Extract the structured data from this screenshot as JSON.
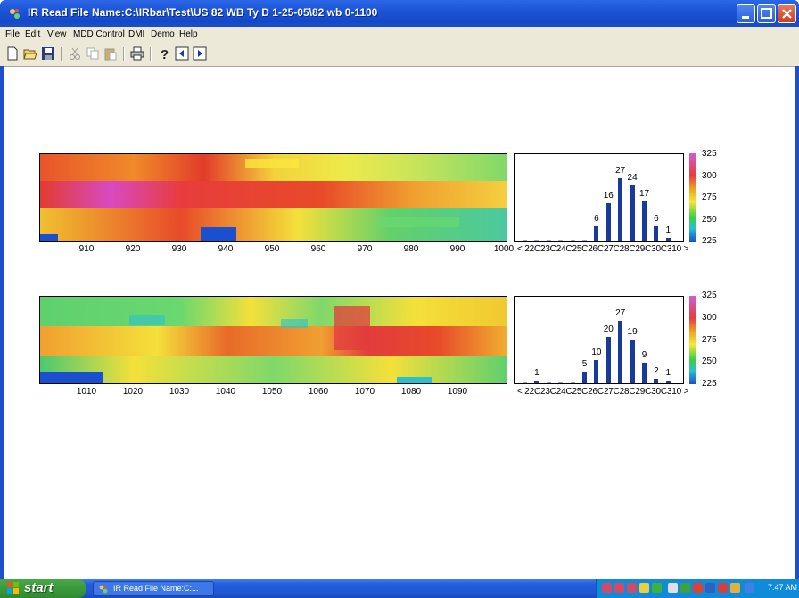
{
  "window": {
    "title": "IR Read File Name:C:\\IRbar\\Test\\US 82 WB Ty D 1-25-05\\82 wb 0-1100"
  },
  "menu": [
    "File",
    "Edit",
    "View",
    "MDD Control",
    "DMI",
    "Demo",
    "Help"
  ],
  "toolbar": {
    "icons": [
      "new-icon",
      "open-icon",
      "save-icon",
      "cut-icon",
      "copy-icon",
      "paste-icon",
      "print-icon",
      "help-icon",
      "previous-icon",
      "next-icon"
    ]
  },
  "heatmaps": [
    {
      "ticks": [
        "910",
        "920",
        "930",
        "940",
        "950",
        "960",
        "970",
        "980",
        "990",
        "1000"
      ]
    },
    {
      "ticks": [
        "1010",
        "1020",
        "1030",
        "1040",
        "1050",
        "1060",
        "1070",
        "1080",
        "1090"
      ]
    }
  ],
  "chart_data": [
    {
      "type": "bar",
      "categories": [
        "<",
        "22",
        "23",
        "24",
        "25",
        "26",
        "27",
        "28",
        "29",
        "30",
        "31",
        "0",
        ">"
      ],
      "category_text": "< 22C23C24C25C26C27C28C29C30C310 >",
      "values": [
        0,
        0,
        0,
        0,
        0,
        0,
        6,
        16,
        27,
        24,
        17,
        6,
        1
      ],
      "labels": [
        "",
        "",
        "",
        "",
        "",
        "",
        "6",
        "16",
        "27",
        "24",
        "17",
        "6",
        "1"
      ],
      "ylim": [
        0,
        30
      ]
    },
    {
      "type": "bar",
      "categories": [
        "<",
        "22",
        "23",
        "24",
        "25",
        "26",
        "27",
        "28",
        "29",
        "30",
        "31",
        "0",
        ">"
      ],
      "category_text": "< 22C23C24C25C26C27C28C29C30C310 >",
      "values": [
        0,
        1,
        0,
        0,
        0,
        5,
        10,
        20,
        27,
        19,
        9,
        2,
        1
      ],
      "labels": [
        "",
        "1",
        "",
        "",
        "",
        "5",
        "10",
        "20",
        "27",
        "19",
        "9",
        "2",
        "1"
      ],
      "ylim": [
        0,
        30
      ]
    }
  ],
  "colorscale": {
    "labels": [
      "325",
      "300",
      "275",
      "250",
      "225"
    ],
    "colors": [
      "#d35bd0",
      "#e83c3c",
      "#f0a020",
      "#f5e63c",
      "#3ecf3e",
      "#2bbfd0",
      "#1a4fd0"
    ]
  },
  "taskbar": {
    "start_label": "start",
    "task_label": "IR Read File Name:C:...",
    "clock": "7:47 AM"
  }
}
